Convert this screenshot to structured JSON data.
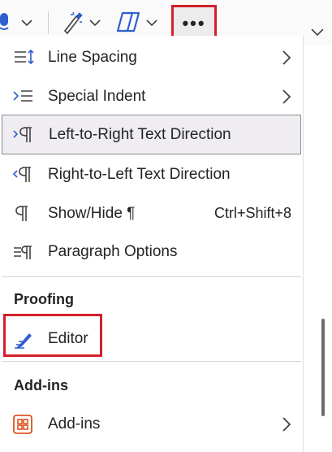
{
  "toolbar": {
    "more_label": "•••"
  },
  "menu": {
    "items": [
      {
        "label": "Line Spacing"
      },
      {
        "label": "Special Indent"
      },
      {
        "label": "Left-to-Right Text Direction"
      },
      {
        "label": "Right-to-Left Text Direction"
      },
      {
        "label": "Show/Hide ¶",
        "shortcut": "Ctrl+Shift+8"
      },
      {
        "label": "Paragraph Options"
      }
    ],
    "proofing": {
      "header": "Proofing",
      "editor_label": "Editor"
    },
    "addins": {
      "header": "Add-ins",
      "item_label": "Add-ins"
    }
  },
  "colors": {
    "highlight_box": "#d3202a",
    "editor_icon": "#2f5fce",
    "addins_icon": "#d83b01",
    "selected_bg": "#f0edf2"
  }
}
